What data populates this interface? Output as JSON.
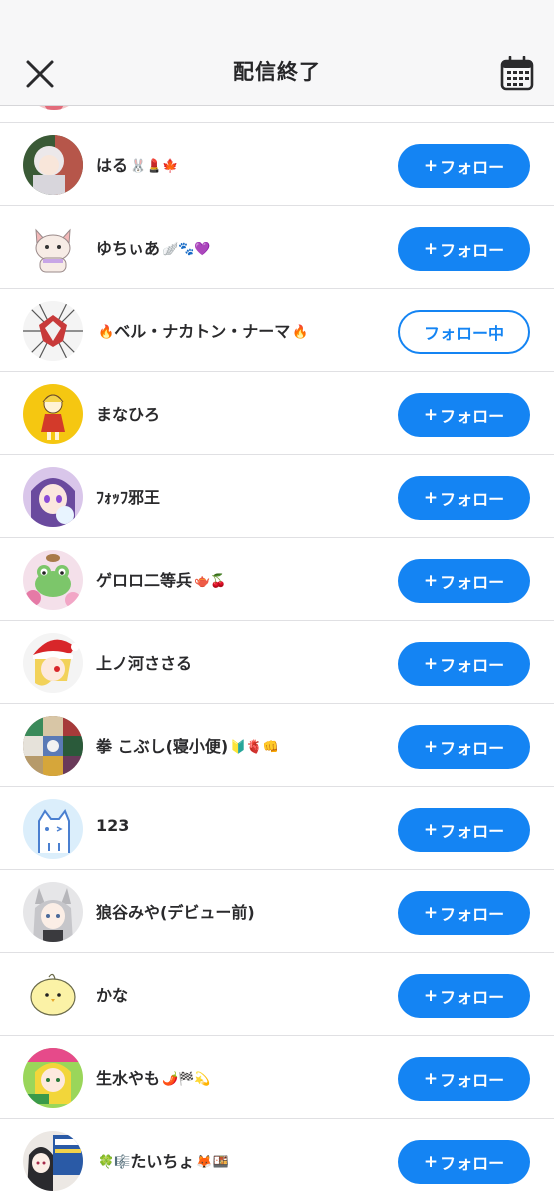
{
  "header": {
    "title": "配信終了",
    "close_icon": "close-icon",
    "calendar_icon": "calendar-icon"
  },
  "colors": {
    "accent": "#1484f3",
    "header_bg": "#f7f7f8",
    "divider": "#e0e0e3"
  },
  "follow_plus": "+",
  "users": [
    {
      "name": "はる",
      "deco": "🐰💄🍁",
      "button": "フォロー",
      "following": false,
      "avatar_icon": "avatar-girl-silver"
    },
    {
      "name": "ゆちぃあ",
      "deco": "🪽🐾💜",
      "button": "フォロー",
      "following": false,
      "avatar_icon": "avatar-dog"
    },
    {
      "name": "ベル・ナカトン・ナーマ",
      "deco_before": "🔥",
      "deco": "🔥",
      "button": "フォロー中",
      "following": true,
      "avatar_icon": "avatar-dragon"
    },
    {
      "name": "まなひろ",
      "deco": "",
      "button": "フォロー",
      "following": false,
      "avatar_icon": "avatar-girl-yellow"
    },
    {
      "name": "ﾌｫｯﾌ邪王",
      "deco": "",
      "button": "フォロー",
      "following": false,
      "avatar_icon": "avatar-girl-purple"
    },
    {
      "name": "ゲロロ二等兵",
      "deco": "🫖🍒",
      "button": "フォロー",
      "following": false,
      "avatar_icon": "avatar-frog"
    },
    {
      "name": "上ノ河ささる",
      "deco": "",
      "button": "フォロー",
      "following": false,
      "avatar_icon": "avatar-girl-santa"
    },
    {
      "name": "拳 こぶし(寝小便)",
      "deco": "🔰🫀👊",
      "button": "フォロー",
      "following": false,
      "avatar_icon": "avatar-collage"
    },
    {
      "name": "123",
      "deco": "",
      "button": "フォロー",
      "following": false,
      "avatar_icon": "avatar-cat-line"
    },
    {
      "name": "狼谷みや(デビュー前)",
      "deco": "",
      "button": "フォロー",
      "following": false,
      "avatar_icon": "avatar-wolf-girl"
    },
    {
      "name": "かな",
      "deco": "",
      "button": "フォロー",
      "following": false,
      "avatar_icon": "avatar-chick"
    },
    {
      "name": "生水やも",
      "deco": "🌶️🏁💫",
      "button": "フォロー",
      "following": false,
      "avatar_icon": "avatar-girl-green"
    },
    {
      "name": "たいちょ",
      "deco_before": "🍀🎼",
      "deco": "🦊🍱",
      "button": "フォロー",
      "following": false,
      "avatar_icon": "avatar-girl-sign"
    }
  ]
}
